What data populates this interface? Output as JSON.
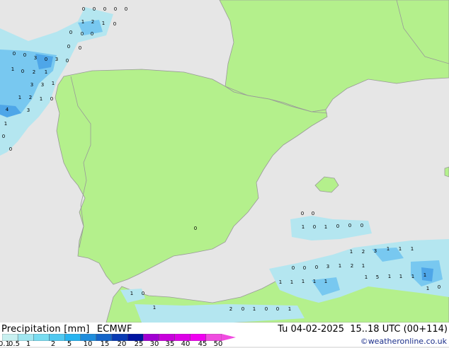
{
  "legend": {
    "title": "Precipitation [mm]",
    "model": "ECMWF",
    "date": "Tu 04-02-2025",
    "time": "15..18 UTC (00+114)",
    "copyright": "©weatheronline.co.uk",
    "scale_labels": [
      "0.1",
      "0.5",
      "1",
      "2",
      "5",
      "10",
      "15",
      "20",
      "25",
      "30",
      "35",
      "40",
      "45",
      "50"
    ],
    "scale_colors": [
      "#c8f0f0",
      "#a0e6f0",
      "#78dcf0",
      "#50c8f0",
      "#28b4f0",
      "#1e8cdc",
      "#1464c8",
      "#0a3cb4",
      "#0014a0",
      "#a000d2",
      "#c800dc",
      "#dc00e6",
      "#f000f0",
      "#f04ce0"
    ]
  },
  "colors": {
    "land": "#b4f08c",
    "sea": "#e6e6e6",
    "border": "#999999",
    "precip_light": "#b4e6f0",
    "precip_mid": "#78c8f0",
    "precip_heavy": "#4ea6e8"
  },
  "precip_labels": [
    "0",
    "0",
    "0",
    "0",
    "0",
    "1",
    "2",
    "1",
    "0",
    "0",
    "0",
    "0",
    "0",
    "0",
    "3",
    "0",
    "3",
    "0",
    "0",
    "0",
    "1",
    "0",
    "2",
    "1",
    "3",
    "3",
    "1",
    "1",
    "2",
    "1",
    "0",
    "4",
    "3",
    "1",
    "0",
    "0",
    "0",
    "0",
    "1",
    "0",
    "1",
    "0",
    "0",
    "0",
    "1",
    "2",
    "3",
    "1",
    "1",
    "1",
    "0",
    "0",
    "0",
    "3",
    "1",
    "2",
    "1",
    "1",
    "1",
    "1",
    "1",
    "1",
    "1",
    "5",
    "1",
    "1",
    "1",
    "1",
    "1",
    "0",
    "1",
    "0",
    "1",
    "2",
    "0",
    "1",
    "0",
    "0",
    "1",
    "0"
  ]
}
